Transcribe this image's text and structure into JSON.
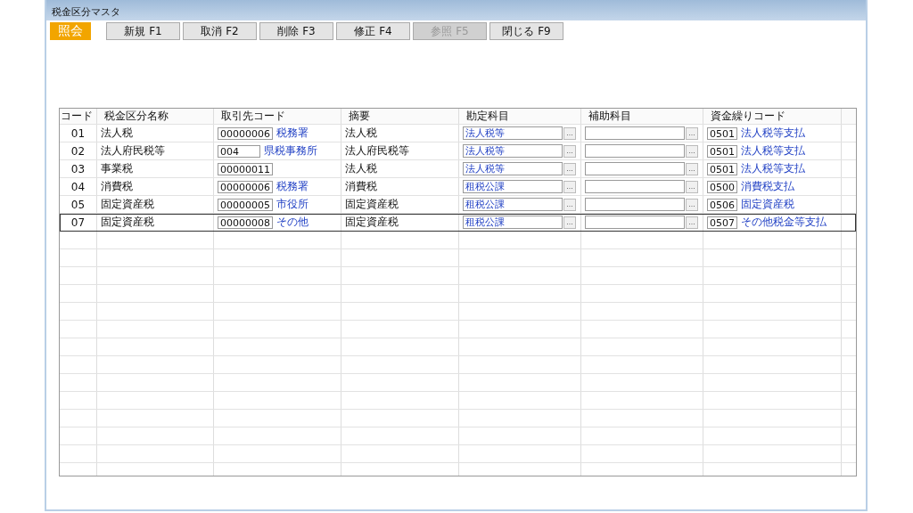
{
  "window": {
    "title": "税金区分マスタ"
  },
  "mode_badge": "照会",
  "buttons": [
    {
      "label": "新規 F1",
      "disabled": false
    },
    {
      "label": "取消 F2",
      "disabled": false
    },
    {
      "label": "削除 F3",
      "disabled": false
    },
    {
      "label": "修正 F4",
      "disabled": false
    },
    {
      "label": "参照 F5",
      "disabled": true
    },
    {
      "label": "閉じる F9",
      "disabled": false
    }
  ],
  "table": {
    "columns": [
      "コード",
      "税金区分名称",
      "取引先コード",
      "摘要",
      "勘定科目",
      "補助科目",
      "資金繰りコード"
    ],
    "rows": [
      {
        "code": "01",
        "name": "法人税",
        "partner_code": "00000006",
        "partner_name": "税務署",
        "summary": "法人税",
        "account": "法人税等",
        "fund_code": "0501",
        "fund_name": "法人税等支払",
        "selected": false
      },
      {
        "code": "02",
        "name": "法人府民税等",
        "partner_code": "004",
        "partner_name": "県税事務所",
        "summary": "法人府民税等",
        "account": "法人税等",
        "fund_code": "0501",
        "fund_name": "法人税等支払",
        "selected": false
      },
      {
        "code": "03",
        "name": "事業税",
        "partner_code": "00000011",
        "summary": "法人税",
        "account": "法人税等",
        "fund_code": "0501",
        "fund_name": "法人税等支払",
        "selected": false
      },
      {
        "code": "04",
        "name": "消費税",
        "partner_code": "00000006",
        "partner_name": "税務署",
        "summary": "消費税",
        "account": "租税公課",
        "fund_code": "0500",
        "fund_name": "消費税支払",
        "selected": false
      },
      {
        "code": "05",
        "name": "固定資産税",
        "partner_code": "00000005",
        "partner_name": "市役所",
        "summary": "固定資産税",
        "account": "租税公課",
        "fund_code": "0506",
        "fund_name": "固定資産税",
        "selected": false
      },
      {
        "code": "07",
        "name": "固定資産税",
        "partner_code": "00000008",
        "partner_name": "その他",
        "summary": "固定資産税",
        "account": "租税公課",
        "fund_code": "0507",
        "fund_name": "その他税金等支払",
        "selected": true
      }
    ]
  }
}
